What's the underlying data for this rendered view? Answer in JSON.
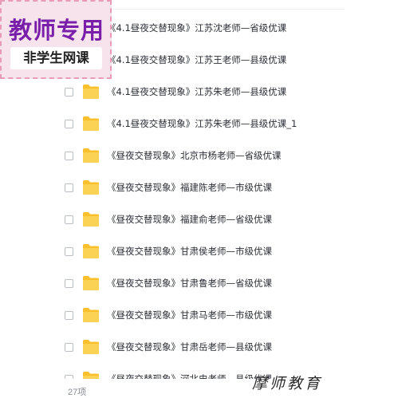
{
  "badge": {
    "title": "教师专用",
    "subtitle": "非学生网课"
  },
  "files": [
    {
      "name": "《4.1昼夜交替现象》江苏沈老师—省级优课"
    },
    {
      "name": "《4.1昼夜交替现象》江苏王老师—县级优课"
    },
    {
      "name": "《4.1昼夜交替现象》江苏朱老师—县级优课"
    },
    {
      "name": "《4.1昼夜交替现象》江苏朱老师—县级优课_1"
    },
    {
      "name": "《昼夜交替现象》北京市杨老师—省级优课"
    },
    {
      "name": "《昼夜交替现象》福建陈老师—市级优课"
    },
    {
      "name": "《昼夜交替现象》福建俞老师—省级优课"
    },
    {
      "name": "《昼夜交替现象》甘肃侯老师—市级优课"
    },
    {
      "name": "《昼夜交替现象》甘肃鲁老师—省级优课"
    },
    {
      "name": "《昼夜交替现象》甘肃马老师—市级优课"
    },
    {
      "name": "《昼夜交替现象》甘肃岳老师—县级优课"
    },
    {
      "name": "《昼夜交替现象》河北史老师—县级优课"
    }
  ],
  "footer": {
    "item_count": "27项",
    "watermark": "摩师教育"
  },
  "colors": {
    "folder": "#f7c02c",
    "badge_text": "#7a1faa",
    "badge_border": "#e89ab8"
  },
  "icons": [
    "folder-icon",
    "checkbox"
  ]
}
